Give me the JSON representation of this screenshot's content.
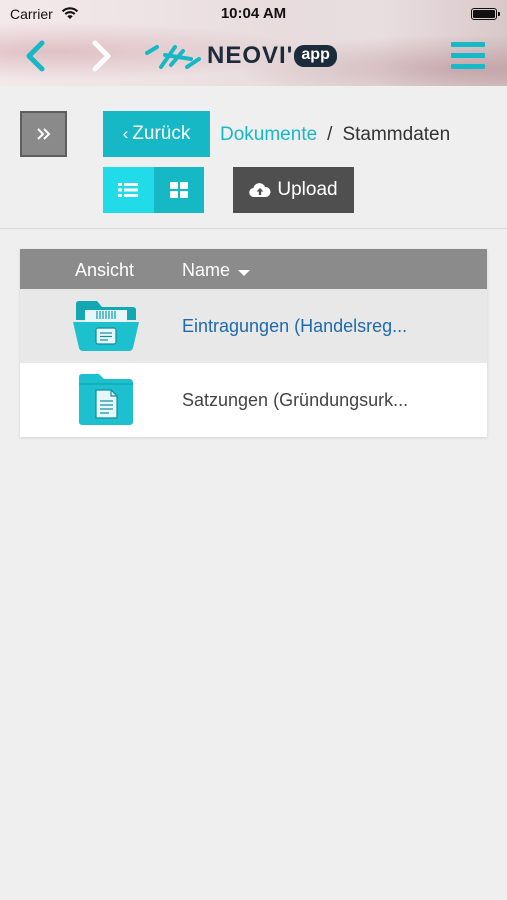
{
  "status_bar": {
    "carrier": "Carrier",
    "time": "10:04 AM",
    "battery_level": 1.0
  },
  "header": {
    "logo_text": "NEOVI'",
    "logo_badge": "app",
    "accent_color": "#17b8c6"
  },
  "toolbar": {
    "back_label": "Zurück",
    "upload_label": "Upload"
  },
  "breadcrumb": {
    "link": "Dokumente",
    "separator": "/",
    "current": "Stammdaten"
  },
  "table": {
    "columns": [
      "Ansicht",
      "Name"
    ],
    "sort_column": "Name",
    "rows": [
      {
        "icon": "folder-open-icon",
        "name": "Eintragungen (Handelsreg...",
        "highlighted": true
      },
      {
        "icon": "folder-document-icon",
        "name": "Satzungen (Gründungsurk...",
        "highlighted": false
      }
    ]
  }
}
